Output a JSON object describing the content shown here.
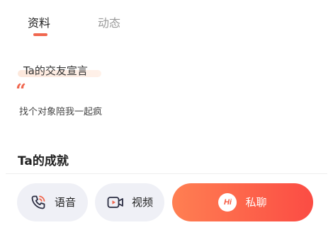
{
  "tabs": [
    {
      "label": "资料",
      "active": true
    },
    {
      "label": "动态",
      "active": false
    }
  ],
  "declaration": {
    "title": "Ta的交友宣言",
    "text": "找个对象陪我一起疯"
  },
  "achievements": {
    "title": "Ta的成就"
  },
  "actions": {
    "voice_label": "语音",
    "video_label": "视频",
    "chat_label": "私聊"
  },
  "colors": {
    "accent": "#f0674f",
    "chat_gradient_start": "#ff7f52",
    "chat_gradient_end": "#fb4c44",
    "pill_bg": "#eff0f6"
  },
  "icons": {
    "voice": "phone-call-icon",
    "video": "video-camera-icon",
    "chat": "hi-bubble-icon",
    "quote": "quote-icon"
  }
}
